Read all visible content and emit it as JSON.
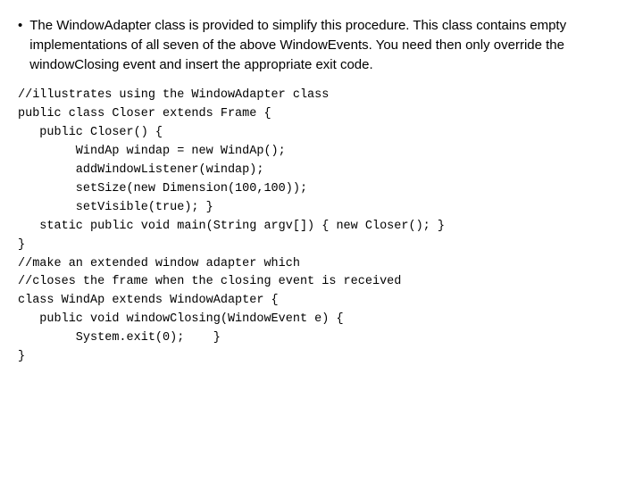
{
  "bullet": {
    "dot": "•",
    "text": "The WindowAdapter class is provided to simplify this procedure. This class contains empty implementations of all seven of the above WindowEvents. You need then only override the windowClosing event and insert the appropriate exit code."
  },
  "code": {
    "lines": [
      "//illustrates using the WindowAdapter class",
      "public class Closer extends Frame {",
      "   public Closer() {",
      "        WindAp windap = new WindAp();",
      "        addWindowListener(windap);",
      "        setSize(new Dimension(100,100));",
      "        setVisible(true); }",
      "   static public void main(String argv[]) { new Closer(); }",
      "}",
      "//make an extended window adapter which",
      "//closes the frame when the closing event is received",
      "class WindAp extends WindowAdapter {",
      "   public void windowClosing(WindowEvent e) {",
      "        System.exit(0);    }",
      "}"
    ]
  }
}
